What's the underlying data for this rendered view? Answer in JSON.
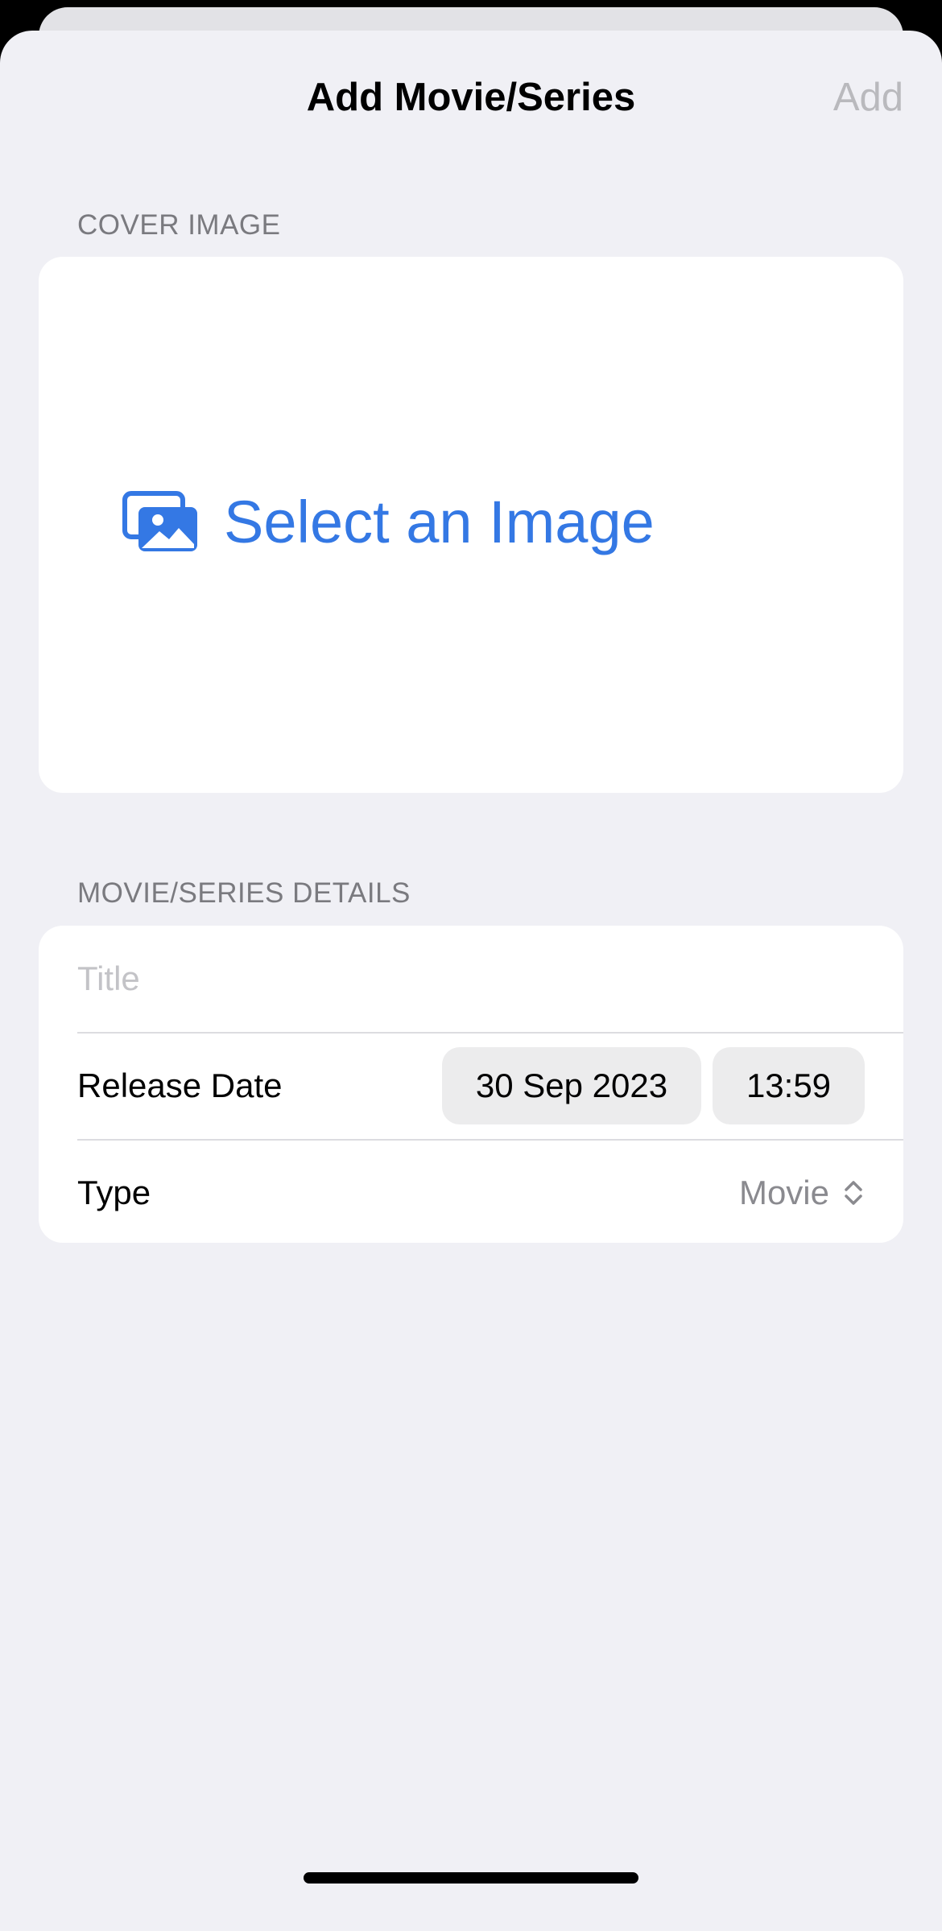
{
  "nav": {
    "title": "Add Movie/Series",
    "add_label": "Add"
  },
  "cover_section": {
    "header": "COVER IMAGE",
    "select_label": "Select an Image",
    "icon": "photo-on-rectangle-icon"
  },
  "details_section": {
    "header": "MOVIE/SERIES DETAILS",
    "title_placeholder": "Title",
    "release_date_label": "Release Date",
    "date_value": "30 Sep 2023",
    "time_value": "13:59",
    "type_label": "Type",
    "type_value": "Movie",
    "type_icon": "chevron-up-down-icon"
  },
  "colors": {
    "accent": "#3478e4",
    "background": "#f0f0f5",
    "disabled": "#b9b9bd"
  }
}
